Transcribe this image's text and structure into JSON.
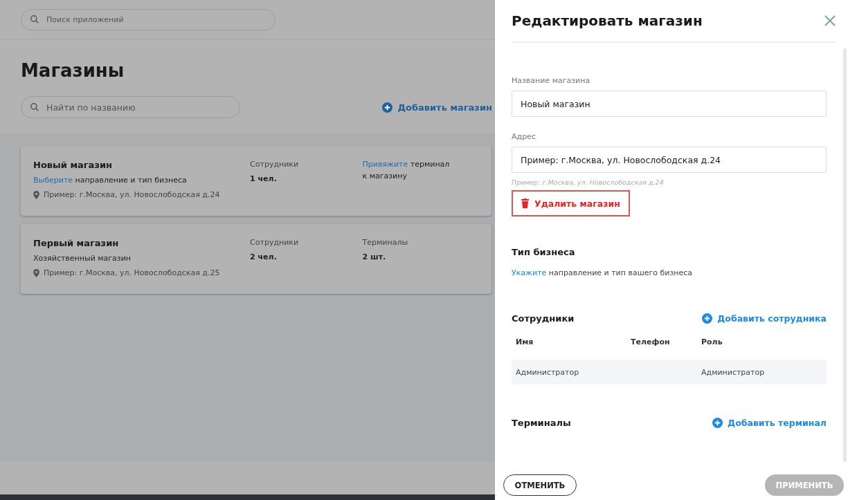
{
  "topbar": {
    "search": {
      "placeholder": "Поиск приложений"
    }
  },
  "page": {
    "title": "Магазины",
    "search": {
      "placeholder": "Найти по названию"
    },
    "add_button": "Добавить магазин"
  },
  "stores": [
    {
      "name": "Новый магазин",
      "business": {
        "link": "Выберите",
        "text": "направление и тип бизнеса"
      },
      "address": "Пример: г.Москва, ул. Новослободская д.24",
      "staff": {
        "label": "Сотрудники",
        "value": "1 чел."
      },
      "terminals": {
        "kind": "link_note",
        "link": "Привяжите",
        "text": "терминал",
        "line2": "к магазину"
      }
    },
    {
      "name": "Первый магазин",
      "business": {
        "text": "Хозяйственный магазин"
      },
      "address": "Пример: г.Москва, ул. Новослободская д.25",
      "staff": {
        "label": "Сотрудники",
        "value": "2 чел."
      },
      "terminals": {
        "kind": "stat",
        "label": "Терминалы",
        "value": "2 шт."
      }
    }
  ],
  "panel": {
    "title": "Редактировать магазин",
    "fields": [
      {
        "label": "Название магазина",
        "value": "Новый магазин"
      },
      {
        "label": "Адрес",
        "value": "Пример: г.Москва, ул. Новослободская д.24",
        "hint": "Пример: г.Москва, ул. Новослободская д.24"
      }
    ],
    "delete_button": "Удалить магазин",
    "business_type": {
      "title": "Тип бизнеса",
      "link": "Укажите",
      "text": "направление и тип вашего бизнеса"
    },
    "employees": {
      "title": "Сотрудники",
      "add_button": "Добавить  сотрудника",
      "columns": [
        "Имя",
        "Телефон",
        "Роль"
      ],
      "rows": [
        [
          "Администратор",
          "",
          "Администратор"
        ]
      ]
    },
    "terminals": {
      "title": "Терминалы",
      "add_button": "Добавить терминал"
    },
    "cancel_button": {
      "label": "ОТМЕНИТЬ",
      "disabled": false
    },
    "apply_button": {
      "label": "ПРИМЕНИТЬ",
      "disabled": true
    }
  }
}
